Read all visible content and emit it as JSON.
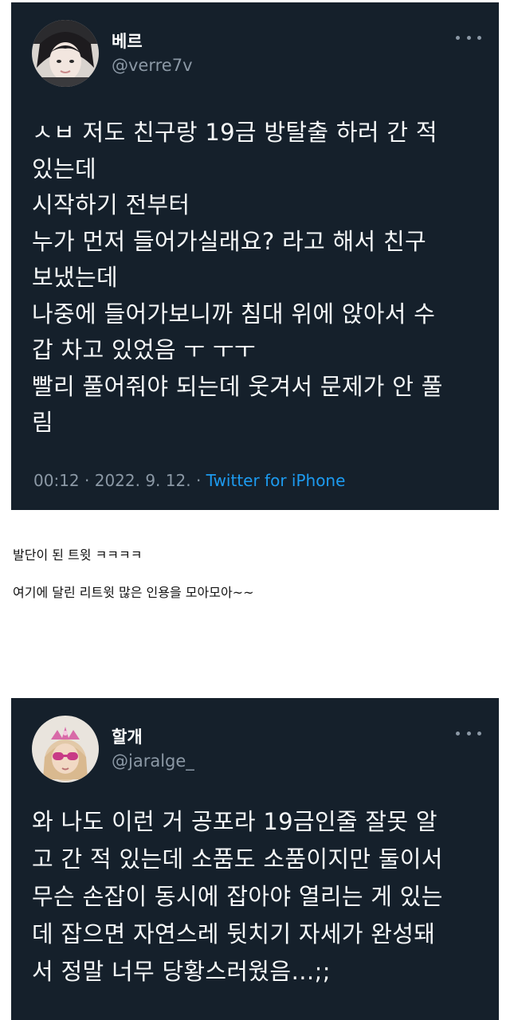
{
  "tweets": [
    {
      "display_name": "베르",
      "handle": "@verre7v",
      "avatar_icon": "user-avatar-photo",
      "text_lines": [
        "ㅅㅂ 저도 친구랑 19금 방탈출 하러 간 적",
        "있는데",
        "시작하기 전부터",
        "누가 먼저 들어가실래요? 라고 해서 친구",
        "보냈는데",
        "나중에 들어가보니까 침대 위에 앉아서 수",
        "갑 차고 있었음 ㅜ ㅜㅜ",
        "빨리 풀어줘야 되는데 웃겨서 문제가 안 풀",
        "림"
      ],
      "time": "00:12",
      "date": "2022. 9. 12.",
      "source": "Twitter for iPhone"
    },
    {
      "display_name": "할개",
      "handle": "@jaralge_",
      "avatar_icon": "user-avatar-photo",
      "text_lines": [
        "와 나도 이런 거 공포라 19금인줄 잘못 알",
        "고 간 적 있는데 소품도 소품이지만 둘이서",
        "무슨 손잡이 동시에 잡아야 열리는 게 있는",
        "데 잡으면 자연스레 뒷치기 자세가 완성돼",
        "서 정말 너무 당황스러웠음…;;"
      ]
    }
  ],
  "captions": {
    "line1": "발단이 된 트윗 ㅋㅋㅋㅋ",
    "line2": "여기에 달린 리트윗 많은 인용을 모아모아~~"
  },
  "colors": {
    "tweet_bg": "#15202b",
    "text": "#f7f9f9",
    "muted": "#8b98a5",
    "link": "#1d9bf0"
  }
}
